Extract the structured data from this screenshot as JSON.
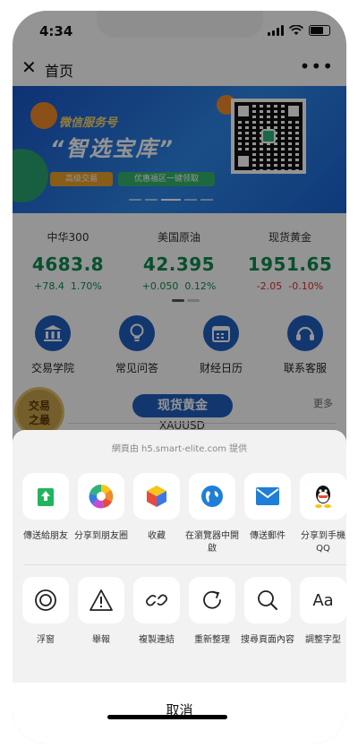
{
  "status_bar": {
    "time": "4:34"
  },
  "navbar": {
    "title": "首页"
  },
  "banner": {
    "subtitle": "微信服务号",
    "title": "“智选宝库”",
    "tag1": "高级交易",
    "tag2": "优惠福区一键领取"
  },
  "quotes": [
    {
      "name": "中华300",
      "price": "4683.8",
      "change": "+78.4",
      "percent": "1.70%",
      "trend": "up"
    },
    {
      "name": "美国原油",
      "price": "42.395",
      "change": "+0.050",
      "percent": "0.12%",
      "trend": "up"
    },
    {
      "name": "现货黄金",
      "price": "1951.65",
      "change": "-2.05",
      "percent": "-0.10%",
      "trend": "down"
    }
  ],
  "features": [
    {
      "label": "交易学院",
      "icon": "bank-icon"
    },
    {
      "label": "常见问答",
      "icon": "lightbulb-icon"
    },
    {
      "label": "财经日历",
      "icon": "calendar-icon"
    },
    {
      "label": "联系客服",
      "icon": "headset-icon"
    }
  ],
  "gold": {
    "badge_line1": "交易",
    "badge_line2": "之最",
    "title": "现货黄金",
    "code": "XAUUSD",
    "more": "更多"
  },
  "sheet": {
    "header": "網頁由 h5.smart-elite.com 提供",
    "row1": [
      {
        "label": "傳送給朋友",
        "icon": "send-to-friend-icon"
      },
      {
        "label": "分享到朋友圈",
        "icon": "moments-icon"
      },
      {
        "label": "收藏",
        "icon": "favorite-icon"
      },
      {
        "label": "在瀏覽器中開啟",
        "icon": "browser-icon"
      },
      {
        "label": "傳送郵件",
        "icon": "mail-icon"
      },
      {
        "label": "分享到手機QQ",
        "icon": "qq-icon"
      }
    ],
    "row2": [
      {
        "label": "浮窗",
        "icon": "float-window-icon"
      },
      {
        "label": "舉報",
        "icon": "report-icon"
      },
      {
        "label": "複製連結",
        "icon": "link-icon"
      },
      {
        "label": "重新整理",
        "icon": "refresh-icon"
      },
      {
        "label": "搜尋頁面內容",
        "icon": "search-icon"
      },
      {
        "label": "調整字型",
        "icon": "font-size-icon"
      }
    ],
    "cancel": "取消"
  }
}
